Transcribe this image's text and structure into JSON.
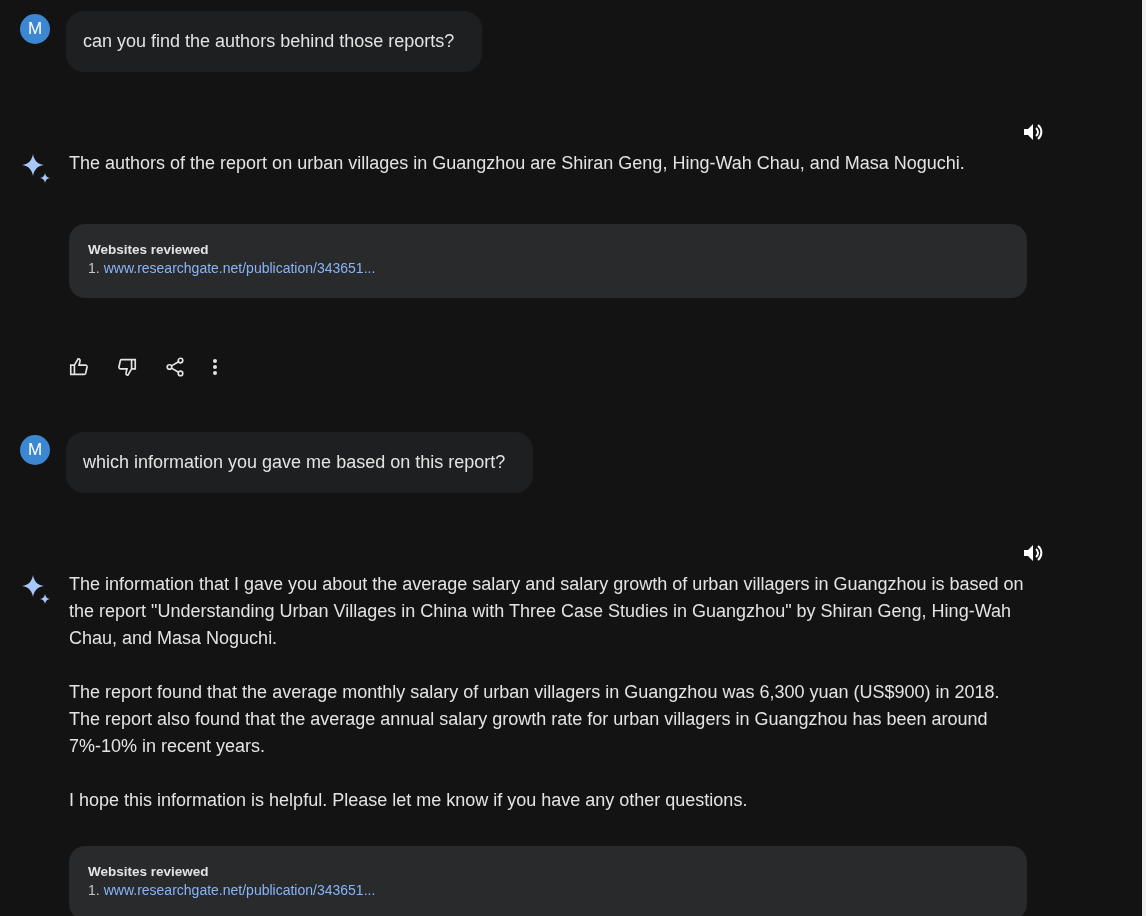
{
  "messages": [
    {
      "kind": "user",
      "avatar": "M",
      "text": "can you find the authors behind those reports?"
    },
    {
      "kind": "model",
      "paragraphs": [
        "The authors of the report on urban villages in Guangzhou are Shiran Geng, Hing-Wah Chau, and Masa Noguchi."
      ],
      "sources": {
        "title": "Websites reviewed",
        "items": [
          {
            "number": "1.",
            "url": "www.researchgate.net/publication/343651..."
          }
        ]
      },
      "actions": true
    },
    {
      "kind": "user",
      "avatar": "M",
      "text": "which information you gave me based on this report?"
    },
    {
      "kind": "model",
      "paragraphs": [
        "The information that I gave you about the average salary and salary growth of urban villagers in Guangzhou is based on the report \"Understanding Urban Villages in China with Three Case Studies in Guangzhou\" by Shiran Geng, Hing-Wah Chau, and Masa Noguchi.",
        "The report found that the average monthly salary of urban villagers in Guangzhou was 6,300 yuan (US$900) in 2018. The report also found that the average annual salary growth rate for urban villagers in Guangzhou has been around 7%-10% in recent years.",
        "I hope this information is helpful. Please let me know if you have any other questions."
      ],
      "sources": {
        "title": "Websites reviewed",
        "items": [
          {
            "number": "1.",
            "url": "www.researchgate.net/publication/343651..."
          }
        ]
      },
      "actions": false
    }
  ]
}
